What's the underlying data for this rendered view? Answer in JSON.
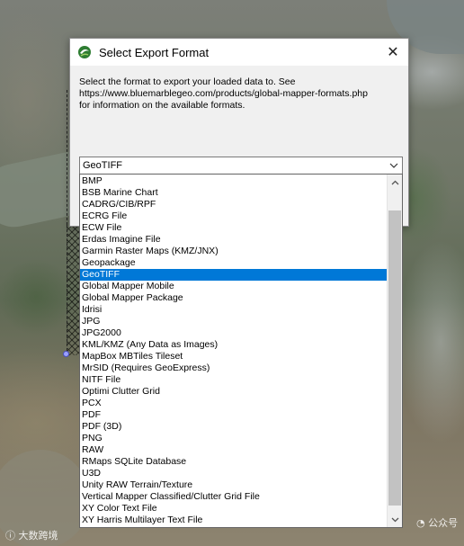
{
  "dialog": {
    "title": "Select Export Format",
    "description_lines": [
      "Select the format to export your loaded data to. See",
      "https://www.bluemarblegeo.com/products/global-mapper-formats.php",
      "for information on the available formats."
    ],
    "close_symbol": "✕",
    "icon": "globe-app-icon"
  },
  "combo": {
    "selected": "GeoTIFF",
    "icon": "chevron-down-icon"
  },
  "dropdown": {
    "selected_index": 8,
    "options": [
      "BMP",
      "BSB Marine Chart",
      "CADRG/CIB/RPF",
      "ECRG File",
      "ECW File",
      "Erdas Imagine File",
      "Garmin Raster Maps (KMZ/JNX)",
      "Geopackage",
      "GeoTIFF",
      "Global Mapper Mobile",
      "Global Mapper Package",
      "Idrisi",
      "JPG",
      "JPG2000",
      "KML/KMZ (Any Data as Images)",
      "MapBox MBTiles Tileset",
      "MrSID (Requires GeoExpress)",
      "NITF File",
      "Optimi Clutter Grid",
      "PCX",
      "PDF",
      "PDF (3D)",
      "PNG",
      "RAW",
      "RMaps SQLite Database",
      "U3D",
      "Unity RAW Terrain/Texture",
      "Vertical Mapper Classified/Clutter Grid File",
      "XY Color Text File",
      "XY Harris Multilayer Text File"
    ],
    "selection_color": "#0078d7"
  },
  "watermarks": {
    "left": "大数跨境",
    "right": "公众号"
  }
}
